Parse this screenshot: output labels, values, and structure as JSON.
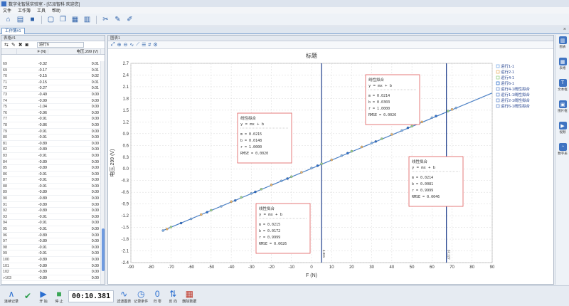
{
  "window": {
    "title": "数字化智慧实验室 - [亿派智科 欢迎您]"
  },
  "menu": [
    "文件",
    "工作簿",
    "工具",
    "帮助"
  ],
  "toolbar_icons": [
    "home-icon",
    "open-folder-icon",
    "save-icon",
    "new-sheet-icon",
    "copy-icon",
    "table-icon",
    "chart-icon",
    "tools-icon",
    "edit-icon",
    "pen-icon"
  ],
  "workbook_tab": "工作簿#1",
  "left_panel": {
    "title": "表格#1",
    "run_select": "运行6",
    "col_f": "F (N)",
    "col_v": "电压,299 (V)",
    "rows": [
      [
        "69",
        "-0.32",
        "0.01"
      ],
      [
        "69",
        "-0.17",
        "0.01"
      ],
      [
        "70",
        "-0.15",
        "0.02"
      ],
      [
        "71",
        "-0.15",
        "0.01"
      ],
      [
        "72",
        "-0.27",
        "0.01"
      ],
      [
        "73",
        "-0.49",
        "0.00"
      ],
      [
        "74",
        "-0.99",
        "0.00"
      ],
      [
        "75",
        "-1.04",
        "0.00"
      ],
      [
        "76",
        "-0.96",
        "0.00"
      ],
      [
        "77",
        "-0.91",
        "0.00"
      ],
      [
        "78",
        "-0.86",
        "0.00"
      ],
      [
        "79",
        "-0.91",
        "0.00"
      ],
      [
        "80",
        "-0.91",
        "0.00"
      ],
      [
        "81",
        "-0.89",
        "0.00"
      ],
      [
        "82",
        "-0.89",
        "0.00"
      ],
      [
        "83",
        "-0.91",
        "0.00"
      ],
      [
        "84",
        "-0.89",
        "0.00"
      ],
      [
        "85",
        "-0.89",
        "0.00"
      ],
      [
        "86",
        "-0.91",
        "0.00"
      ],
      [
        "87",
        "-0.91",
        "0.00"
      ],
      [
        "88",
        "-0.91",
        "0.00"
      ],
      [
        "89",
        "-0.89",
        "0.00"
      ],
      [
        "90",
        "-0.89",
        "0.00"
      ],
      [
        "91",
        "-0.89",
        "0.00"
      ],
      [
        "92",
        "-0.89",
        "0.00"
      ],
      [
        "93",
        "-0.91",
        "0.00"
      ],
      [
        "94",
        "-0.91",
        "0.00"
      ],
      [
        "95",
        "-0.91",
        "0.00"
      ],
      [
        "96",
        "-0.89",
        "0.00"
      ],
      [
        "97",
        "-0.89",
        "0.00"
      ],
      [
        "98",
        "-0.91",
        "0.00"
      ],
      [
        "99",
        "-0.91",
        "0.00"
      ],
      [
        "100",
        "-0.89",
        "0.00"
      ],
      [
        "101",
        "-0.89",
        "0.00"
      ],
      [
        "102",
        "-0.89",
        "0.00"
      ],
      [
        ">103",
        "-0.89",
        "0.00"
      ]
    ]
  },
  "chart_panel": {
    "title": "图表1"
  },
  "right_sidebar": [
    "图表",
    "表格",
    "文本框",
    "图片框",
    "视频",
    "数字表"
  ],
  "bottom_bar": {
    "start_record": "连续记录",
    "start": "开 始",
    "stop": "停 止",
    "timer": "00:10.381",
    "filter": "滤波图表",
    "record_cond": "记录条件",
    "zero": "归 零",
    "reverse": "反 向",
    "delete": "删除数据"
  },
  "colors": {
    "accent": "#2b6fd0",
    "fit_box_border": "#e05a5a",
    "line_blue": "#1f3e8c"
  },
  "chart_data": {
    "type": "scatter",
    "title": "标题",
    "xlabel": "F (N)",
    "ylabel": "电压,299 (V)",
    "xlim": [
      -90,
      90
    ],
    "ylim": [
      -2.4,
      2.7
    ],
    "x_ticks": [
      -90,
      -80,
      -70,
      -60,
      -50,
      -40,
      -30,
      -20,
      -10,
      0,
      10,
      20,
      30,
      40,
      50,
      60,
      70,
      80,
      90
    ],
    "y_ticks": [
      -2.4,
      -2.1,
      -1.8,
      -1.5,
      -1.2,
      -0.9,
      -0.6,
      -0.3,
      0,
      0.3,
      0.6,
      0.9,
      1.2,
      1.5,
      1.8,
      2.1,
      2.4,
      2.7
    ],
    "grid": true,
    "legend_position": "top-right",
    "series": [
      {
        "name": "运行1-1",
        "color": "#7fb0e8",
        "x": [
          -74,
          -60,
          -45,
          -30,
          -15,
          0,
          15,
          30,
          45,
          60,
          72
        ],
        "y": [
          -1.58,
          -1.28,
          -0.96,
          -0.63,
          -0.31,
          0.02,
          0.34,
          0.66,
          0.98,
          1.31,
          1.56
        ]
      },
      {
        "name": "运行2-1",
        "color": "#e8b46c",
        "x": [
          -72,
          -55,
          -40,
          -20,
          -5,
          10,
          25,
          40,
          55,
          70
        ],
        "y": [
          -1.54,
          -1.17,
          -0.84,
          -0.41,
          -0.09,
          0.23,
          0.56,
          0.88,
          1.2,
          1.52
        ]
      },
      {
        "name": "运行4-1",
        "color": "#9ad08a",
        "x": [
          -70,
          -50,
          -35,
          -25,
          -10,
          5,
          20,
          35,
          50,
          68
        ],
        "y": [
          -1.49,
          -1.06,
          -0.73,
          -0.52,
          -0.2,
          0.13,
          0.45,
          0.77,
          1.09,
          1.48
        ]
      },
      {
        "name": "运行6-1",
        "color": "#2d6fcc",
        "x": [
          -65,
          -52,
          -38,
          -28,
          -12,
          3,
          18,
          32,
          48,
          62
        ],
        "y": [
          -1.39,
          -1.11,
          -0.81,
          -0.59,
          -0.25,
          0.08,
          0.4,
          0.7,
          1.05,
          1.35
        ]
      }
    ],
    "fit_legend": [
      "运行4-1线性拟合",
      "运行1-1线性拟合",
      "运行2-1线性拟合",
      "运行6-1线性拟合"
    ],
    "vertical_lines": [
      {
        "x": 5.0,
        "label": "4.961"
      },
      {
        "x": 67.2,
        "label": "67.227"
      }
    ],
    "fit_boxes": [
      {
        "title": "线性拟合",
        "eq": "y = mx + b",
        "lines": [
          "m      = 0.0215",
          "b      = 0.0148",
          "r      = 1.0000",
          "RMSE   = 0.0020"
        ]
      },
      {
        "title": "线性拟合",
        "eq": "y = mx + b",
        "lines": [
          "m      = 0.0214",
          "b      = 0.0303",
          "r      = 1.0000",
          "RMSE   = 0.0026"
        ]
      },
      {
        "title": "线性拟合",
        "eq": "y = mx + b",
        "lines": [
          "m      = 0.0215",
          "b      = 0.0172",
          "r      = 0.9999",
          "RMSE   = 0.0026"
        ]
      },
      {
        "title": "线性拟合",
        "eq": "y = mx + b",
        "lines": [
          "m      = 0.0214",
          "b      = 0.0081",
          "r      = 0.9999",
          "RMSE   = 0.0046"
        ]
      }
    ]
  }
}
